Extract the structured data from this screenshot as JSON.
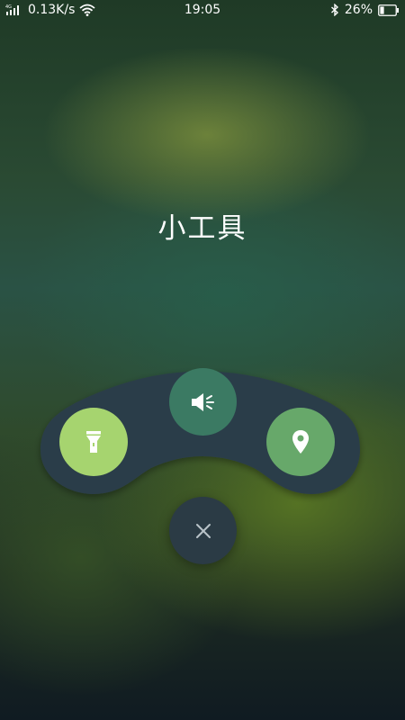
{
  "status_bar": {
    "network_speed": "0.13K/s",
    "time": "19:05",
    "battery_percent": "26%",
    "battery_level": 0.26,
    "icons": [
      "signal-icon",
      "wifi-icon",
      "bluetooth-icon",
      "battery-icon"
    ]
  },
  "title": "小工具",
  "tools": [
    {
      "name": "flashlight",
      "icon": "flashlight-icon",
      "color": "#a6d46f"
    },
    {
      "name": "sound",
      "icon": "speaker-icon",
      "color": "#3b7a63"
    },
    {
      "name": "location",
      "icon": "location-pin-icon",
      "color": "#67a86a"
    }
  ],
  "close": {
    "icon": "close-icon",
    "color": "#2b3b45"
  },
  "colors": {
    "panel": "#2c3e4a",
    "text": "#ffffff"
  }
}
